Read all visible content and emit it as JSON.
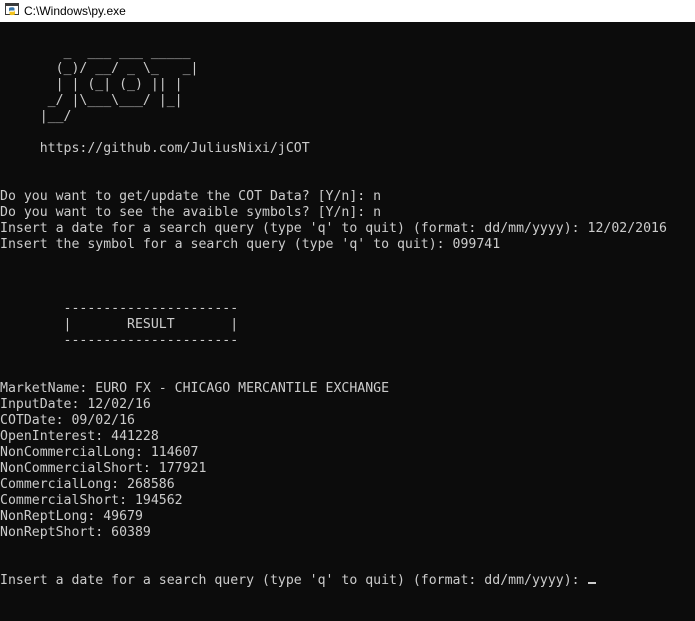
{
  "window": {
    "title": "C:\\Windows\\py.exe",
    "icon": "python-console-icon"
  },
  "console": {
    "lines": [
      "",
      "        _  ___ ___ _____",
      "       (_)/ __/ _ \\_   _|",
      "       | | (_| (_) || |",
      "      _/ |\\___\\___/ |_|",
      "     |__/",
      "",
      "     https://github.com/JuliusNixi/jCOT",
      "",
      "",
      "Do you want to get/update the COT Data? [Y/n]: n",
      "Do you want to see the avaible symbols? [Y/n]: n",
      "Insert a date for a search query (type 'q' to quit) (format: dd/mm/yyyy): 12/02/2016",
      "Insert the symbol for a search query (type 'q' to quit): 099741",
      "",
      "",
      "",
      "        ----------------------",
      "        |       RESULT       |",
      "        ----------------------",
      "",
      "",
      "MarketName: EURO FX - CHICAGO MERCANTILE EXCHANGE",
      "InputDate: 12/02/16",
      "COTDate: 09/02/16",
      "OpenInterest: 441228",
      "NonCommercialLong: 114607",
      "NonCommercialShort: 177921",
      "CommercialLong: 268586",
      "CommercialShort: 194562",
      "NonReptLong: 49679",
      "NonReptShort: 60389",
      "",
      "",
      "Insert a date for a search query (type 'q' to quit) (format: dd/mm/yyyy): "
    ]
  },
  "colors": {
    "background": "#0c0c0c",
    "foreground": "#cccccc",
    "titlebar": "#ffffff"
  }
}
